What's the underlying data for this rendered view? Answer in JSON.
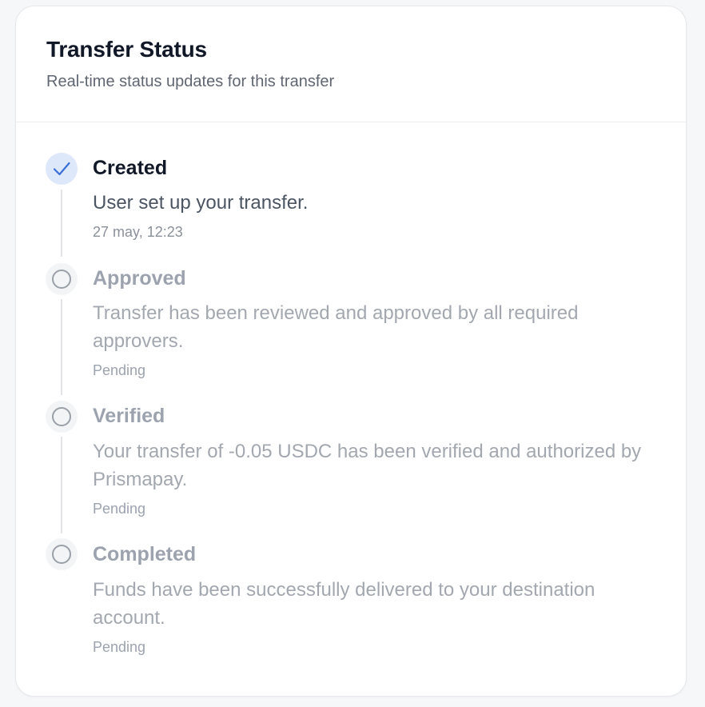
{
  "header": {
    "title": "Transfer Status",
    "subtitle": "Real-time status updates for this transfer"
  },
  "colors": {
    "accent": "#3b6fd8",
    "completed_icon_bg": "#dde8fb",
    "pending_icon_bg": "#f3f4f6",
    "pending_text": "#9ca3af"
  },
  "steps": [
    {
      "title": "Created",
      "description": "User set up your transfer.",
      "meta": "27 may, 12:23",
      "status": "completed",
      "icon": "check-icon"
    },
    {
      "title": "Approved",
      "description": "Transfer has been reviewed and approved by all required approvers.",
      "meta": "Pending",
      "status": "pending",
      "icon": "empty-circle-icon"
    },
    {
      "title": "Verified",
      "description": "Your transfer of -0.05 USDC has been verified and authorized by Prismapay.",
      "meta": "Pending",
      "status": "pending",
      "icon": "empty-circle-icon"
    },
    {
      "title": "Completed",
      "description": "Funds have been successfully delivered to your destination account.",
      "meta": "Pending",
      "status": "pending",
      "icon": "empty-circle-icon"
    }
  ]
}
